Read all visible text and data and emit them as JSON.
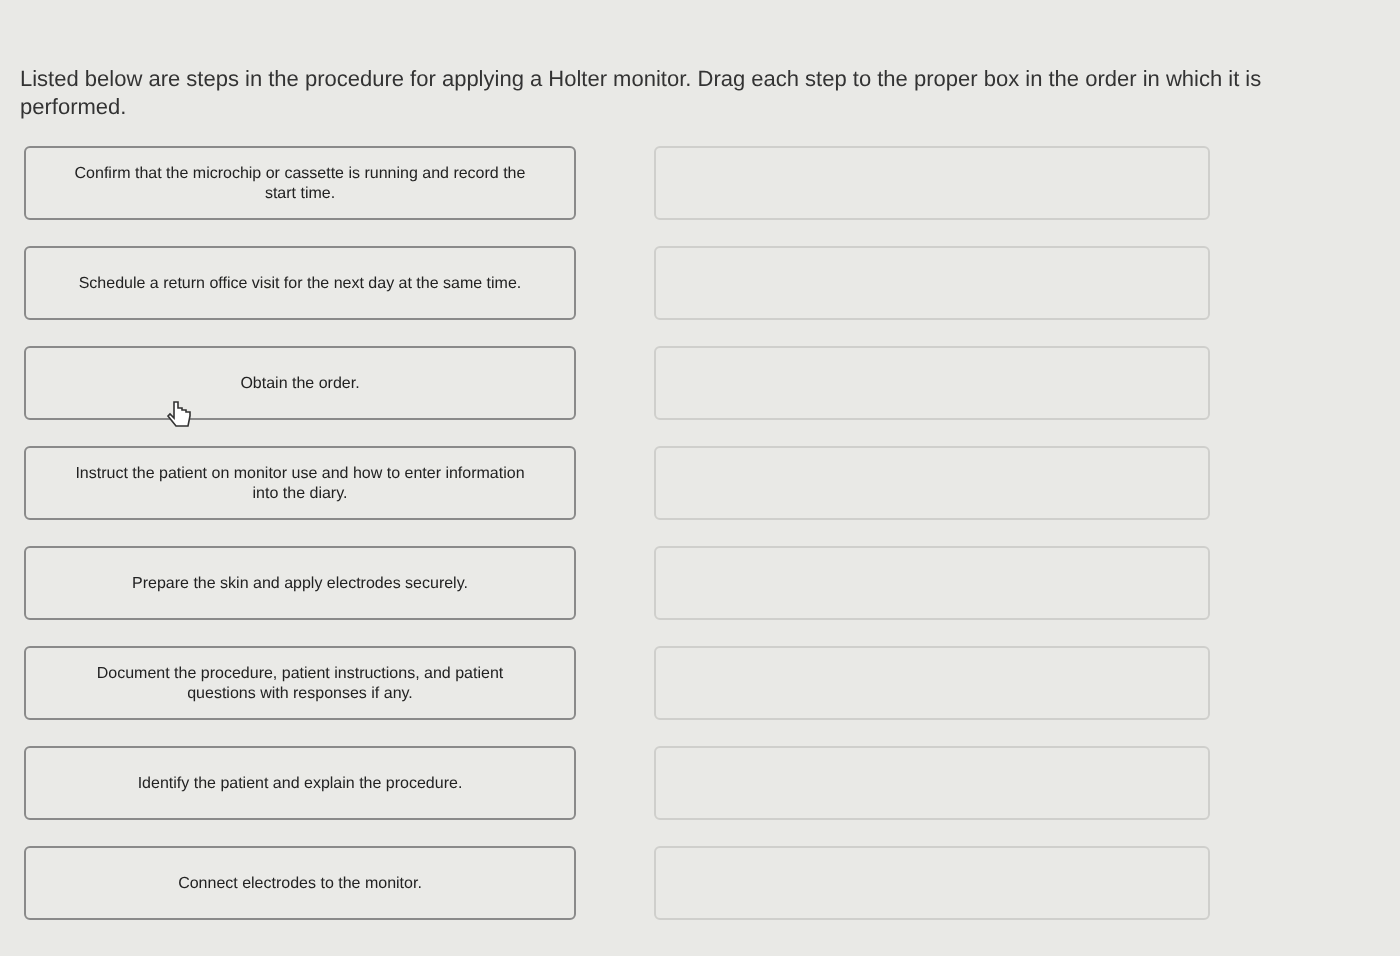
{
  "instructions": "Listed below are steps in the procedure for applying a Holter monitor. Drag each step to the proper box in the order in which it is performed.",
  "steps": [
    {
      "label": "Confirm that the microchip or cassette is running and record the start time."
    },
    {
      "label": "Schedule a return office visit for the next day at the same time."
    },
    {
      "label": "Obtain the order."
    },
    {
      "label": "Instruct the patient on monitor use and how to enter information into the diary."
    },
    {
      "label": "Prepare the skin and apply electrodes securely."
    },
    {
      "label": "Document the procedure, patient instructions, and patient questions with responses if any."
    },
    {
      "label": "Identify the patient and explain the procedure."
    },
    {
      "label": "Connect electrodes to the monitor."
    }
  ]
}
